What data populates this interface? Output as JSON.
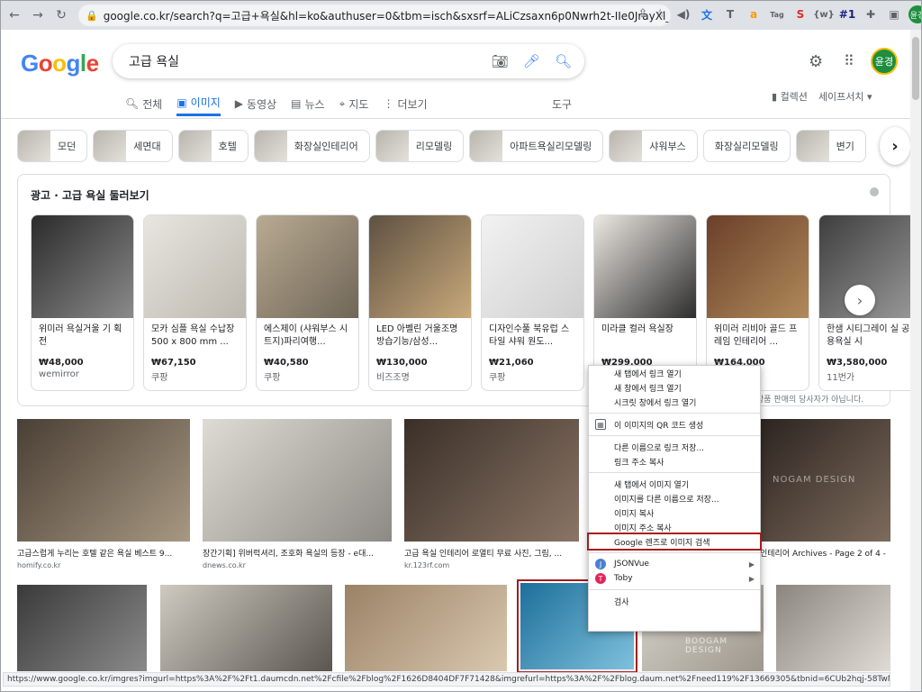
{
  "browser": {
    "url": "google.co.kr/search?q=고급+욕실&hl=ko&authuser=0&tbm=isch&sxsrf=ALiCzsaxn6p0Nwrh2t-IIe0JrayXl_dnVQ%3A16...",
    "profile_initials": "윤경"
  },
  "google": {
    "logo": "Google",
    "query": "고급 욕실",
    "avatar": "윤경"
  },
  "tabs": [
    {
      "label": "전체",
      "icon": "search-icon"
    },
    {
      "label": "이미지",
      "icon": "image-icon"
    },
    {
      "label": "동영상",
      "icon": "video-icon"
    },
    {
      "label": "뉴스",
      "icon": "news-icon"
    },
    {
      "label": "지도",
      "icon": "map-pin-icon"
    },
    {
      "label": "더보기",
      "icon": "more-vert-icon"
    }
  ],
  "tools_label": "도구",
  "collections_label": "컬렉션",
  "safesearch_label": "세이프서치 ▾",
  "chips": [
    "모던",
    "세면대",
    "호텔",
    "화장실인테리어",
    "리모델링",
    "아파트욕실리모델링",
    "샤워부스",
    "화장실리모델링",
    "변기"
  ],
  "ad": {
    "title": "광고 · 고급 욕실 둘러보기",
    "disclaimer": "상품 판매의 당사자가 아닙니다.",
    "cards": [
      {
        "title": "위미러 욕실거울 기 획전",
        "price": "₩48,000",
        "seller": "wemirror",
        "color1": "#2b2b2b",
        "color2": "#8a8a8a"
      },
      {
        "title": "모카 심플 욕실 수납장 500 x 800 mm ...",
        "price": "₩67,150",
        "seller": "쿠팡",
        "color1": "#e8e6e1",
        "color2": "#bdb8ae"
      },
      {
        "title": "에스제이 (샤워부스 시트지)파리여행...",
        "price": "₩40,580",
        "seller": "쿠팡",
        "color1": "#b9aa92",
        "color2": "#6f6657"
      },
      {
        "title": "LED 아벨린 거울조명방습기능/삼성...",
        "price": "₩130,000",
        "seller": "비즈조명",
        "color1": "#5e5142",
        "color2": "#c9a97a"
      },
      {
        "title": "디자인수풀 북유럽 스타일 샤워 원도...",
        "price": "₩21,060",
        "seller": "쿠팡",
        "color1": "#f2f2f2",
        "color2": "#cfcfcf"
      },
      {
        "title": "미라클 컬러 욕실장",
        "price": "₩299,000",
        "seller": "",
        "color1": "#ece8e2",
        "color2": "#2d2d2d"
      },
      {
        "title": "위미러 리비아 골드 프레임 인테리어 ...",
        "price": "₩164,000",
        "seller": "",
        "color1": "#6b3f2a",
        "color2": "#b08a5a"
      },
      {
        "title": "한샘 시티그레이 실 공용욕실 시",
        "price": "₩3,580,000",
        "seller": "11번가",
        "color1": "#3e3e3e",
        "color2": "#9b9b9b"
      }
    ]
  },
  "results_row1": [
    {
      "caption": "고급스럽게 누리는 호텔 같은 욕실 베스트 9...",
      "source": "homify.co.kr",
      "color1": "#4a3f35",
      "color2": "#a79882"
    },
    {
      "caption": "장간기획] 위버럭셔리, 조호화 욕실의 등장 - e대...",
      "source": "dnews.co.kr",
      "color1": "#dedbd4",
      "color2": "#8d8a85"
    },
    {
      "caption": "고급 욕실 인테리어 로열티 무료 사진, 그림, ...",
      "source": "kr.123rf.com",
      "color1": "#3a2f28",
      "color2": "#8a7565"
    },
    {
      "caption": "인테리어 Archives - Page 2 of 4 -",
      "source": "",
      "color1": "#2c2420",
      "color2": "#7d6b5c"
    }
  ],
  "results_row2": [
    {
      "color1": "#3a3a3a",
      "color2": "#8a8a8a"
    },
    {
      "color1": "#cfcac0",
      "color2": "#5b5650"
    },
    {
      "color1": "#9b8266",
      "color2": "#d9c8b0"
    },
    {
      "color1": "#1d6f9a",
      "color2": "#7fc1dd"
    },
    {
      "color1": "#d8d4cc",
      "color2": "#9d978c"
    },
    {
      "color1": "#8b8580",
      "color2": "#e0dcd5"
    }
  ],
  "watermarks": {
    "w1": "NOGAM DESIGN",
    "w2": "BOOGAM DESIGN"
  },
  "context_menu": {
    "items": [
      {
        "label": "새 탭에서 링크 열기"
      },
      {
        "label": "새 창에서 링크 열기"
      },
      {
        "label": "시크릿 창에서 링크 열기"
      },
      {
        "sep": true
      },
      {
        "label": "이 이미지의 QR 코드 생성",
        "icon": "qr-code-icon"
      },
      {
        "sep": true
      },
      {
        "label": "다른 이름으로 링크 저장..."
      },
      {
        "label": "링크 주소 복사"
      },
      {
        "sep": true
      },
      {
        "label": "새 탭에서 이미지 열기"
      },
      {
        "label": "이미지를 다른 이름으로 저장..."
      },
      {
        "label": "이미지 복사"
      },
      {
        "label": "이미지 주소 복사"
      },
      {
        "label": "Google 렌즈로 이미지 검색",
        "highlight": true
      },
      {
        "sep": true
      },
      {
        "label": "JSONVue",
        "icon": "jsonvue-icon",
        "submenu": true
      },
      {
        "label": "Toby",
        "icon": "toby-icon",
        "submenu": true
      },
      {
        "sep": true
      },
      {
        "label": "검사"
      }
    ]
  },
  "status_url": "https://www.google.co.kr/imgres?imgurl=https%3A%2F%2Ft1.daumcdn.net%2Fcfile%2Fblog%2F1626D8404DF7F71428&imgrefurl=https%3A%2F%2Fblog.daum.net%2Fneed119%2F13669305&tbnid=6CUb2hqj-58TwM&vet=12ahUKEwibv...",
  "colors": {
    "google_blue": "#1a73e8",
    "highlight_red": "#a61c1c"
  }
}
